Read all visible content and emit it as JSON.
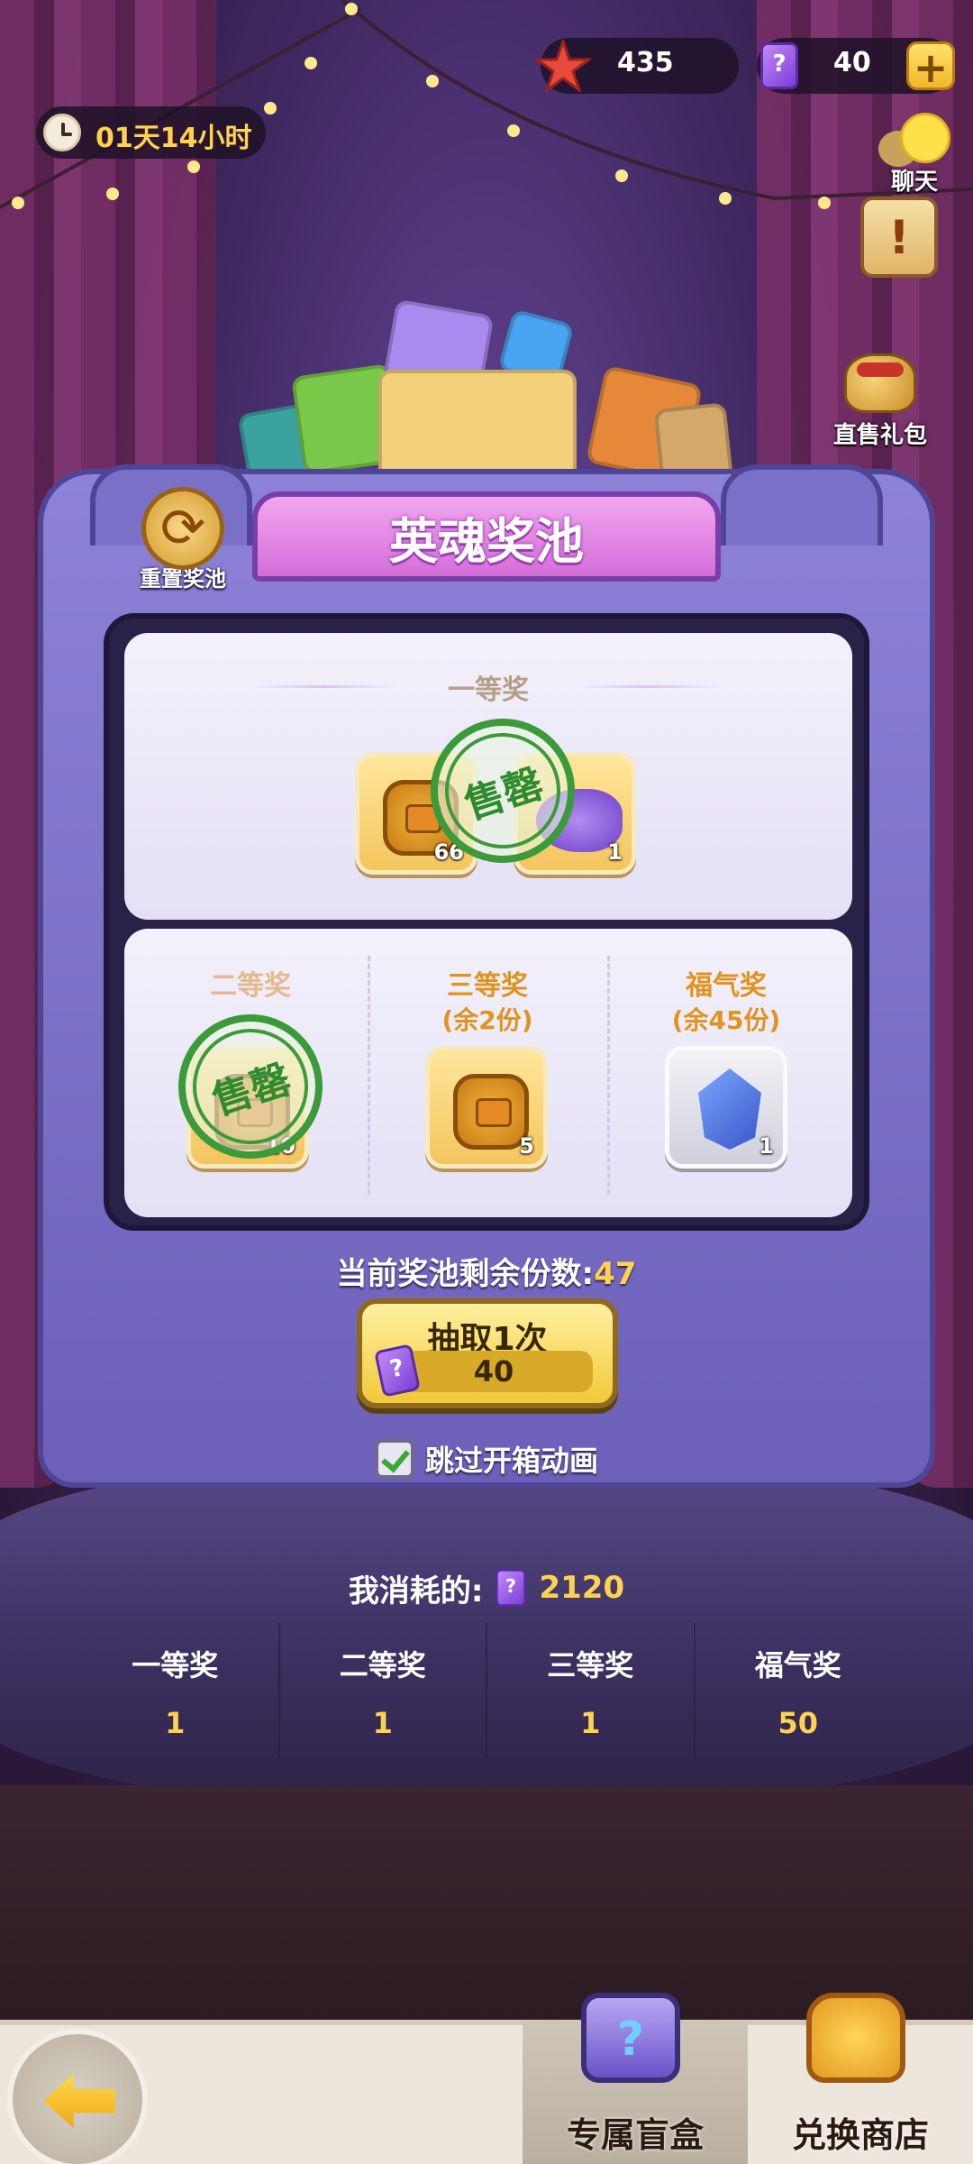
{
  "currencies": {
    "starfish": {
      "value": "435",
      "icon": "starfish-icon",
      "color": "#e74a3c"
    },
    "ticket": {
      "value": "40",
      "icon": "ticket-icon",
      "color": "#8a4ee0"
    }
  },
  "timer": {
    "text": "01天14小时",
    "icon": "clock-icon"
  },
  "side_buttons": {
    "chat": "聊天",
    "gift": "直售礼包"
  },
  "pool": {
    "title": "英魂奖池",
    "reset_label": "重置奖池",
    "sold_out": "售罄",
    "first_prize": {
      "title": "一等奖",
      "items": [
        {
          "icon": "gold-coin-icon",
          "count": "66"
        },
        {
          "icon": "purple-dragon-icon",
          "count": "1"
        }
      ]
    },
    "second_prize": {
      "title": "二等奖",
      "items": [
        {
          "icon": "gold-coin-icon",
          "count": "10"
        }
      ]
    },
    "third_prize": {
      "title": "三等奖",
      "remaining": "(余2份)",
      "items": [
        {
          "icon": "gold-coin-icon",
          "count": "5"
        }
      ]
    },
    "lucky_prize": {
      "title": "福气奖",
      "remaining": "(余45份)",
      "items": [
        {
          "icon": "blue-crystal-icon",
          "count": "1"
        }
      ]
    },
    "remaining_label": "当前奖池剩余份数:",
    "remaining_value": "47"
  },
  "draw": {
    "label": "抽取1次",
    "cost": "40"
  },
  "skip_animation": {
    "label": "跳过开箱动画",
    "checked": true
  },
  "consumed": {
    "label": "我消耗的:",
    "value": "2120"
  },
  "stats": [
    {
      "label": "一等奖",
      "value": "1"
    },
    {
      "label": "二等奖",
      "value": "1"
    },
    {
      "label": "三等奖",
      "value": "1"
    },
    {
      "label": "福气奖",
      "value": "50"
    }
  ],
  "nav": {
    "mystery_box": "专属盲盒",
    "exchange_shop": "兑换商店"
  }
}
